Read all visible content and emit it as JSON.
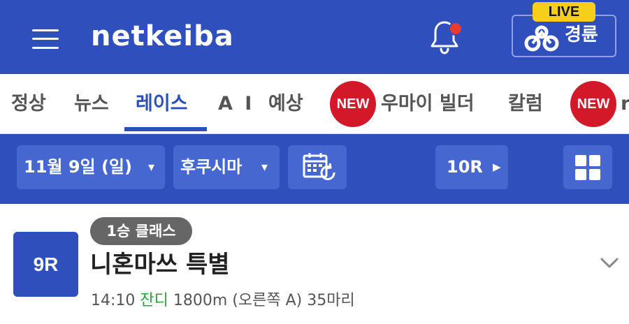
{
  "header": {
    "logo": "netkeiba",
    "live_badge": "LIVE",
    "keirin_label": "경륜",
    "colors": {
      "primary": "#2f4fbd",
      "live": "#f5cf1a",
      "notification": "#e83a2f"
    }
  },
  "tabs": [
    {
      "label": "정상",
      "active": false
    },
    {
      "label": "뉴스",
      "active": false
    },
    {
      "label": "레이스",
      "active": true
    },
    {
      "label": "A I",
      "active": false
    },
    {
      "label": "예상",
      "active": false
    },
    {
      "label": "우마이 빌더",
      "active": false,
      "badge": "NEW"
    },
    {
      "label": "칼럼",
      "active": false
    },
    {
      "label": "r",
      "active": false,
      "badge": "NEW"
    }
  ],
  "filters": {
    "date": "11월 9일 (일)",
    "track": "후쿠시마",
    "next_race": "10R",
    "dropdown_arrow": "▾",
    "next_arrow": "▶"
  },
  "race": {
    "number": "9R",
    "class": "1승 클래스",
    "name": "니혼마쓰 특별",
    "time": "14:10",
    "surface": "잔디",
    "details": "1800m (오른쪽 A) 35마리"
  }
}
